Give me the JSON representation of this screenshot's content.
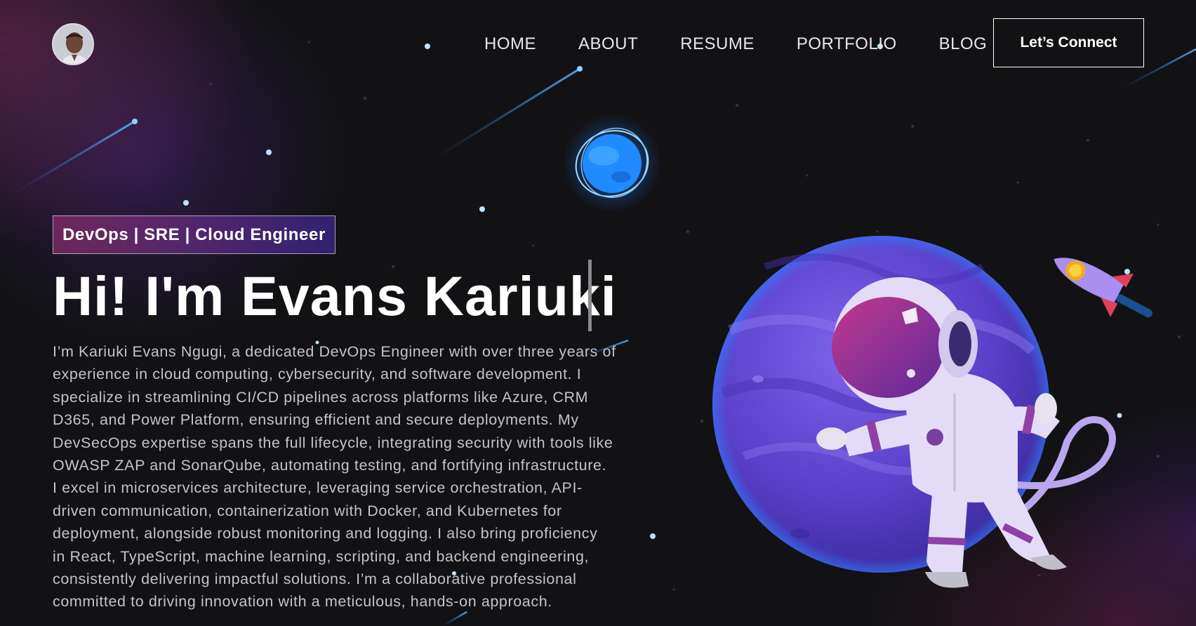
{
  "nav": {
    "items": [
      {
        "label": "HOME"
      },
      {
        "label": "ABOUT"
      },
      {
        "label": "RESUME"
      },
      {
        "label": "PORTFOLIO"
      },
      {
        "label": "BLOG"
      }
    ],
    "cta_label": "Let’s Connect",
    "logo_icon": "profile-avatar"
  },
  "hero": {
    "tagline": "DevOps | SRE | Cloud Engineer",
    "title": "Hi! I'm Evans Kariuki",
    "bio_lines": [
      "I’m Kariuki Evans Ngugi, a dedicated DevOps Engineer with over three years of",
      "experience in cloud computing, cybersecurity, and software development. I",
      "specialize in streamlining CI/CD pipelines across platforms like Azure, CRM",
      "D365, and Power Platform, ensuring efficient and secure deployments. My",
      "DevSecOps expertise spans the full lifecycle, integrating security with tools like",
      "OWASP ZAP and SonarQube, automating testing, and fortifying infrastructure.",
      "I excel in microservices architecture, leveraging service orchestration, API-",
      "driven communication, containerization with Docker, and Kubernetes for",
      "deployment, alongside robust monitoring and logging. I also bring proficiency",
      "in React, TypeScript, machine learning, scripting, and backend engineering,",
      "consistently delivering impactful solutions. I’m a collaborative professional",
      "committed to driving innovation with a meticulous, hands-on approach."
    ]
  },
  "theme": {
    "background": "#121214",
    "accent_pink": "#aa367c",
    "accent_purple": "#4a2fbd",
    "planet_purple": "#6b4fd8"
  },
  "decor_icons": [
    "astronaut-illustration",
    "purple-planet",
    "blue-planet",
    "rocket",
    "shooting-star",
    "star"
  ]
}
